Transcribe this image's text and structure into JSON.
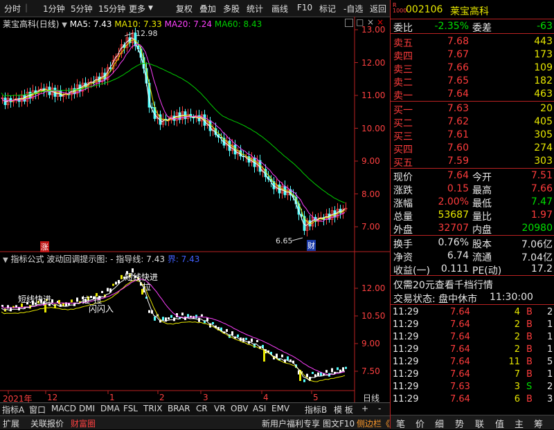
{
  "toolbar": {
    "left_items": [
      "分时",
      "1分钟",
      "5分钟",
      "15分钟",
      "更多"
    ],
    "right_items": [
      "复权",
      "叠加",
      "多股",
      "统计",
      "画线",
      "F10",
      "标记",
      "-自选",
      "返回"
    ]
  },
  "chart": {
    "stock_name": "莱宝高科",
    "period": "(日线)",
    "ma5": "MA5: 7.43",
    "ma10": "MA10: 7.33",
    "ma20": "MA20: 7.24",
    "ma60": "MA60: 8.43",
    "high_label": "12.98",
    "low_label": "6.65",
    "cai_badge": "财",
    "zhang_badge": "涨",
    "y_ticks": [
      "13.00",
      "12.00",
      "11.00",
      "10.00",
      "9.00",
      "8.00",
      "7.00"
    ],
    "indicator": {
      "name": "指标公式",
      "title": "波动回调提示图: -",
      "guide": "指导线: 7.43",
      "jie": "界: 7.43",
      "y_ticks": [
        "12.00",
        "10.50",
        "9.00",
        "7.50"
      ],
      "annotations": [
        "短线快进",
        "拉",
        "拉",
        "闪闪入",
        "短线快进",
        "拉"
      ]
    },
    "x_labels": [
      "2021年",
      "12",
      "1",
      "2",
      "3",
      "4",
      "5"
    ],
    "period_label": "日线"
  },
  "bottom_tabs": [
    "指标A",
    "窗口",
    "MACD",
    "DMI",
    "DMA",
    "FSL",
    "TRIX",
    "BRAR",
    "CR",
    "VR",
    "OBV",
    "ASI",
    "EMV",
    "指标B",
    "模 板",
    "+",
    "-"
  ],
  "status_bar": {
    "left": [
      "扩展",
      "关联报价",
      "财富圈"
    ],
    "right": [
      "新用户福利专享",
      "图文F10",
      "侧边栏《"
    ]
  },
  "quote": {
    "code": "002106",
    "name": "莱宝高科",
    "weibi_label": "委比",
    "weibi": "-2.35%",
    "weicha_label": "委差",
    "weicha": "-63",
    "sell": [
      {
        "label": "卖五",
        "price": "7.68",
        "vol": "443"
      },
      {
        "label": "卖四",
        "price": "7.67",
        "vol": "173"
      },
      {
        "label": "卖三",
        "price": "7.66",
        "vol": "109"
      },
      {
        "label": "卖二",
        "price": "7.65",
        "vol": "182"
      },
      {
        "label": "卖一",
        "price": "7.64",
        "vol": "463"
      }
    ],
    "buy": [
      {
        "label": "买一",
        "price": "7.63",
        "vol": "20"
      },
      {
        "label": "买二",
        "price": "7.62",
        "vol": "405"
      },
      {
        "label": "买三",
        "price": "7.61",
        "vol": "305"
      },
      {
        "label": "买四",
        "price": "7.60",
        "vol": "274"
      },
      {
        "label": "买五",
        "price": "7.59",
        "vol": "303"
      }
    ],
    "stats": [
      {
        "l1": "现价",
        "v1": "7.64",
        "l2": "今开",
        "v2": "7.51"
      },
      {
        "l1": "涨跌",
        "v1": "0.15",
        "l2": "最高",
        "v2": "7.66"
      },
      {
        "l1": "涨幅",
        "v1": "2.00%",
        "l2": "最低",
        "v2": "7.47"
      },
      {
        "l1": "总量",
        "v1": "53687",
        "l2": "量比",
        "v2": "1.97"
      },
      {
        "l1": "外盘",
        "v1": "32707",
        "l2": "内盘",
        "v2": "20980"
      }
    ],
    "stats2": [
      {
        "l1": "换手",
        "v1": "0.76%",
        "l2": "股本",
        "v2": "7.06亿"
      },
      {
        "l1": "净资",
        "v1": "6.74",
        "l2": "流通",
        "v2": "7.04亿"
      },
      {
        "l1": "收益(一)",
        "v1": "0.111",
        "l2": "PE(动)",
        "v2": "17.2"
      }
    ],
    "promo": "仅需20元查看千档行情",
    "trade_status": "交易状态: 盘中休市",
    "trade_time": "11:30:00",
    "ticks": [
      {
        "t": "11:29",
        "p": "7.64",
        "v": "4",
        "d": "B",
        "n": "2"
      },
      {
        "t": "11:29",
        "p": "7.64",
        "v": "2",
        "d": "B",
        "n": "1"
      },
      {
        "t": "11:29",
        "p": "7.64",
        "v": "2",
        "d": "B",
        "n": "1"
      },
      {
        "t": "11:29",
        "p": "7.64",
        "v": "2",
        "d": "B",
        "n": "1"
      },
      {
        "t": "11:29",
        "p": "7.64",
        "v": "11",
        "d": "B",
        "n": "5"
      },
      {
        "t": "11:29",
        "p": "7.64",
        "v": "7",
        "d": "B",
        "n": "1"
      },
      {
        "t": "11:29",
        "p": "7.63",
        "v": "3",
        "d": "S",
        "n": "2"
      },
      {
        "t": "11:29",
        "p": "7.64",
        "v": "6",
        "d": "B",
        "n": "3"
      }
    ],
    "bottom_nav": [
      "笔",
      "价",
      "细",
      "势",
      "联",
      "值",
      "主",
      "筹"
    ]
  },
  "colors": {
    "up": "#ff3c3c",
    "down": "#54ffff",
    "ma5": "#ffffff",
    "ma10": "#e8e800",
    "ma20": "#ff40ff",
    "ma60": "#00d000"
  }
}
